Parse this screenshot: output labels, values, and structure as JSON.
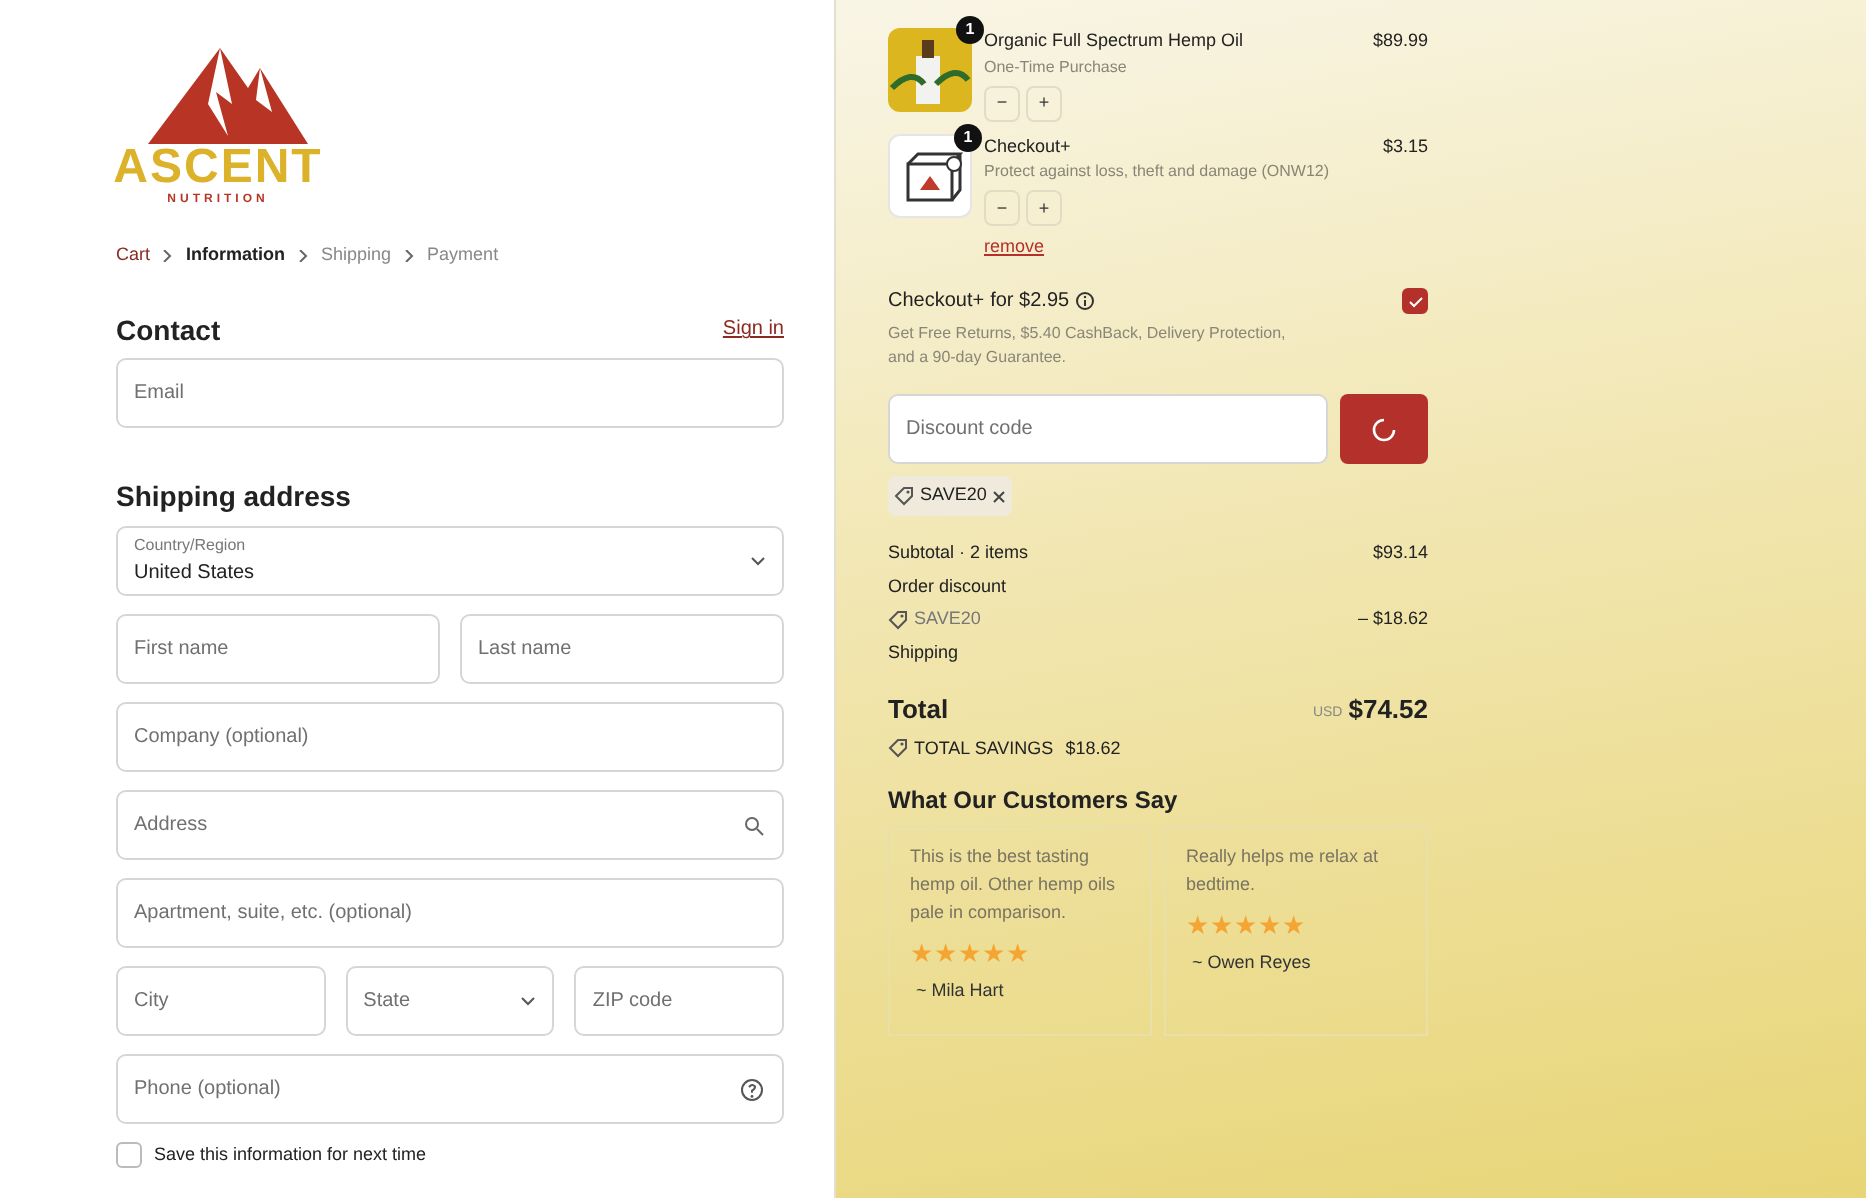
{
  "logo": {
    "brand": "ASCENT",
    "tagline": "NUTRITION"
  },
  "breadcrumb": [
    {
      "label": "Cart",
      "kind": "link",
      "selected": false
    },
    {
      "label": "Information",
      "kind": "current",
      "selected": true
    },
    {
      "label": "Shipping",
      "kind": "pending",
      "selected": false
    },
    {
      "label": "Payment",
      "kind": "pending",
      "selected": false
    }
  ],
  "contact": {
    "title": "Contact",
    "sign_in": "Sign in",
    "email": {
      "placeholder": "Email"
    }
  },
  "shipping_address": {
    "title": "Shipping address",
    "rows": [
      [
        {
          "kind": "select",
          "label": "Country/Region",
          "value": "United States"
        }
      ],
      [
        {
          "kind": "input",
          "placeholder": "First name"
        },
        {
          "kind": "input",
          "placeholder": "Last name"
        }
      ],
      [
        {
          "kind": "input",
          "placeholder": "Company (optional)"
        }
      ],
      [
        {
          "kind": "search",
          "placeholder": "Address"
        }
      ],
      [
        {
          "kind": "input",
          "placeholder": "Apartment, suite, etc. (optional)"
        }
      ],
      [
        {
          "kind": "input",
          "placeholder": "City"
        },
        {
          "kind": "select",
          "placeholder": "State"
        },
        {
          "kind": "input",
          "placeholder": "ZIP code"
        }
      ],
      [
        {
          "kind": "help",
          "placeholder": "Phone (optional)"
        }
      ]
    ],
    "save_info": {
      "label": "Save this information for next time",
      "checked": false
    }
  },
  "cart_items": [
    {
      "kind": "product",
      "quantity": "1",
      "name": "Organic Full Spectrum Hemp Oil",
      "subtitle": "One-Time Purchase",
      "price": "$89.99",
      "minus": "−",
      "plus": "+"
    },
    {
      "kind": "protection",
      "quantity": "1",
      "name": "Checkout+",
      "subtitle": "Protect against loss, theft and damage (ONW12)",
      "price": "$3.15",
      "minus": "−",
      "plus": "+",
      "remove": "remove"
    }
  ],
  "checkout_plus": {
    "title": "Checkout+",
    "price_text": "for $2.95",
    "description": "Get Free Returns, $5.40 CashBack, Delivery Protection, and a 90-day Guarantee.",
    "checked": true
  },
  "discount": {
    "placeholder": "Discount code",
    "applied_tag": "SAVE20"
  },
  "summary": {
    "subtotal_label": "Subtotal · 2 items",
    "subtotal": "$93.14",
    "order_discount_label": "Order discount",
    "discount_code": "SAVE20",
    "discount_amount": "– $18.62",
    "shipping_label": "Shipping",
    "total_label": "Total",
    "currency": "USD",
    "total": "$74.52",
    "savings_label": "TOTAL SAVINGS",
    "savings": "$18.62"
  },
  "reviews": {
    "title": "What Our Customers Say",
    "items": [
      {
        "text": "This is the best tasting hemp oil. Other hemp oils pale in comparison.",
        "stars": 5,
        "author": "~ Mila Hart"
      },
      {
        "text": "Really helps me relax at bedtime.",
        "stars": 5,
        "author": "~ Owen Reyes"
      }
    ]
  }
}
